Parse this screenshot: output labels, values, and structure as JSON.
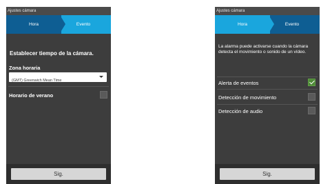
{
  "left_screen": {
    "titlebar": "Ajustes cámara",
    "tabs": [
      {
        "label": "Hora"
      },
      {
        "label": "Evento"
      }
    ],
    "heading": "Establecer tiempo de la cámara.",
    "timezone_label": "Zona horaria",
    "timezone_value": "(GMT) Greenwich Mean Time",
    "dst_label": "Horario de verano",
    "dst_checked": false,
    "next_button": "Sig."
  },
  "right_screen": {
    "titlebar": "Ajustes cámara",
    "tabs": [
      {
        "label": "Hora"
      },
      {
        "label": "Evento"
      }
    ],
    "description": "La alarma puede activarse cuando la cámara detecta el movimiento o sonido de un vídeo.",
    "options": [
      {
        "label": "Alerta de eventos",
        "checked": true
      },
      {
        "label": "Detección de movimiento",
        "checked": false
      },
      {
        "label": "Detección de audio",
        "checked": false
      }
    ],
    "next_button": "Sig."
  },
  "colors": {
    "tab_active": "#1aa6dd",
    "tab_inactive": "#0e5e93",
    "panel": "#3d3d3d",
    "checkbox_checked": "#4e8a37"
  }
}
